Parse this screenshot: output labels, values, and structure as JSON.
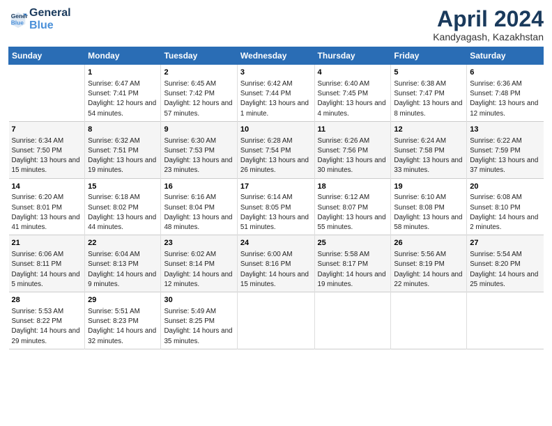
{
  "header": {
    "logo_line1": "General",
    "logo_line2": "Blue",
    "month": "April 2024",
    "location": "Kandyagash, Kazakhstan"
  },
  "days_of_week": [
    "Sunday",
    "Monday",
    "Tuesday",
    "Wednesday",
    "Thursday",
    "Friday",
    "Saturday"
  ],
  "weeks": [
    [
      {
        "day": "",
        "sunrise": "",
        "sunset": "",
        "daylight": ""
      },
      {
        "day": "1",
        "sunrise": "Sunrise: 6:47 AM",
        "sunset": "Sunset: 7:41 PM",
        "daylight": "Daylight: 12 hours and 54 minutes."
      },
      {
        "day": "2",
        "sunrise": "Sunrise: 6:45 AM",
        "sunset": "Sunset: 7:42 PM",
        "daylight": "Daylight: 12 hours and 57 minutes."
      },
      {
        "day": "3",
        "sunrise": "Sunrise: 6:42 AM",
        "sunset": "Sunset: 7:44 PM",
        "daylight": "Daylight: 13 hours and 1 minute."
      },
      {
        "day": "4",
        "sunrise": "Sunrise: 6:40 AM",
        "sunset": "Sunset: 7:45 PM",
        "daylight": "Daylight: 13 hours and 4 minutes."
      },
      {
        "day": "5",
        "sunrise": "Sunrise: 6:38 AM",
        "sunset": "Sunset: 7:47 PM",
        "daylight": "Daylight: 13 hours and 8 minutes."
      },
      {
        "day": "6",
        "sunrise": "Sunrise: 6:36 AM",
        "sunset": "Sunset: 7:48 PM",
        "daylight": "Daylight: 13 hours and 12 minutes."
      }
    ],
    [
      {
        "day": "7",
        "sunrise": "Sunrise: 6:34 AM",
        "sunset": "Sunset: 7:50 PM",
        "daylight": "Daylight: 13 hours and 15 minutes."
      },
      {
        "day": "8",
        "sunrise": "Sunrise: 6:32 AM",
        "sunset": "Sunset: 7:51 PM",
        "daylight": "Daylight: 13 hours and 19 minutes."
      },
      {
        "day": "9",
        "sunrise": "Sunrise: 6:30 AM",
        "sunset": "Sunset: 7:53 PM",
        "daylight": "Daylight: 13 hours and 23 minutes."
      },
      {
        "day": "10",
        "sunrise": "Sunrise: 6:28 AM",
        "sunset": "Sunset: 7:54 PM",
        "daylight": "Daylight: 13 hours and 26 minutes."
      },
      {
        "day": "11",
        "sunrise": "Sunrise: 6:26 AM",
        "sunset": "Sunset: 7:56 PM",
        "daylight": "Daylight: 13 hours and 30 minutes."
      },
      {
        "day": "12",
        "sunrise": "Sunrise: 6:24 AM",
        "sunset": "Sunset: 7:58 PM",
        "daylight": "Daylight: 13 hours and 33 minutes."
      },
      {
        "day": "13",
        "sunrise": "Sunrise: 6:22 AM",
        "sunset": "Sunset: 7:59 PM",
        "daylight": "Daylight: 13 hours and 37 minutes."
      }
    ],
    [
      {
        "day": "14",
        "sunrise": "Sunrise: 6:20 AM",
        "sunset": "Sunset: 8:01 PM",
        "daylight": "Daylight: 13 hours and 41 minutes."
      },
      {
        "day": "15",
        "sunrise": "Sunrise: 6:18 AM",
        "sunset": "Sunset: 8:02 PM",
        "daylight": "Daylight: 13 hours and 44 minutes."
      },
      {
        "day": "16",
        "sunrise": "Sunrise: 6:16 AM",
        "sunset": "Sunset: 8:04 PM",
        "daylight": "Daylight: 13 hours and 48 minutes."
      },
      {
        "day": "17",
        "sunrise": "Sunrise: 6:14 AM",
        "sunset": "Sunset: 8:05 PM",
        "daylight": "Daylight: 13 hours and 51 minutes."
      },
      {
        "day": "18",
        "sunrise": "Sunrise: 6:12 AM",
        "sunset": "Sunset: 8:07 PM",
        "daylight": "Daylight: 13 hours and 55 minutes."
      },
      {
        "day": "19",
        "sunrise": "Sunrise: 6:10 AM",
        "sunset": "Sunset: 8:08 PM",
        "daylight": "Daylight: 13 hours and 58 minutes."
      },
      {
        "day": "20",
        "sunrise": "Sunrise: 6:08 AM",
        "sunset": "Sunset: 8:10 PM",
        "daylight": "Daylight: 14 hours and 2 minutes."
      }
    ],
    [
      {
        "day": "21",
        "sunrise": "Sunrise: 6:06 AM",
        "sunset": "Sunset: 8:11 PM",
        "daylight": "Daylight: 14 hours and 5 minutes."
      },
      {
        "day": "22",
        "sunrise": "Sunrise: 6:04 AM",
        "sunset": "Sunset: 8:13 PM",
        "daylight": "Daylight: 14 hours and 9 minutes."
      },
      {
        "day": "23",
        "sunrise": "Sunrise: 6:02 AM",
        "sunset": "Sunset: 8:14 PM",
        "daylight": "Daylight: 14 hours and 12 minutes."
      },
      {
        "day": "24",
        "sunrise": "Sunrise: 6:00 AM",
        "sunset": "Sunset: 8:16 PM",
        "daylight": "Daylight: 14 hours and 15 minutes."
      },
      {
        "day": "25",
        "sunrise": "Sunrise: 5:58 AM",
        "sunset": "Sunset: 8:17 PM",
        "daylight": "Daylight: 14 hours and 19 minutes."
      },
      {
        "day": "26",
        "sunrise": "Sunrise: 5:56 AM",
        "sunset": "Sunset: 8:19 PM",
        "daylight": "Daylight: 14 hours and 22 minutes."
      },
      {
        "day": "27",
        "sunrise": "Sunrise: 5:54 AM",
        "sunset": "Sunset: 8:20 PM",
        "daylight": "Daylight: 14 hours and 25 minutes."
      }
    ],
    [
      {
        "day": "28",
        "sunrise": "Sunrise: 5:53 AM",
        "sunset": "Sunset: 8:22 PM",
        "daylight": "Daylight: 14 hours and 29 minutes."
      },
      {
        "day": "29",
        "sunrise": "Sunrise: 5:51 AM",
        "sunset": "Sunset: 8:23 PM",
        "daylight": "Daylight: 14 hours and 32 minutes."
      },
      {
        "day": "30",
        "sunrise": "Sunrise: 5:49 AM",
        "sunset": "Sunset: 8:25 PM",
        "daylight": "Daylight: 14 hours and 35 minutes."
      },
      {
        "day": "",
        "sunrise": "",
        "sunset": "",
        "daylight": ""
      },
      {
        "day": "",
        "sunrise": "",
        "sunset": "",
        "daylight": ""
      },
      {
        "day": "",
        "sunrise": "",
        "sunset": "",
        "daylight": ""
      },
      {
        "day": "",
        "sunrise": "",
        "sunset": "",
        "daylight": ""
      }
    ]
  ]
}
